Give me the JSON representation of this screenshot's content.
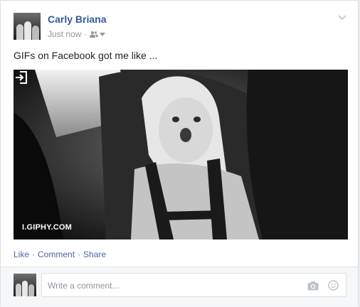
{
  "post": {
    "author": "Carly Briana",
    "timestamp": "Just now",
    "audience_icon": "friends-icon",
    "text": "GIFs on Facebook got me like ...",
    "media": {
      "type": "gif",
      "source_label": "I.GIPHY.COM"
    }
  },
  "actions": {
    "like": "Like",
    "comment": "Comment",
    "share": "Share",
    "separator": "·"
  },
  "comment_box": {
    "placeholder": "Write a comment...",
    "value": ""
  },
  "colors": {
    "link_blue": "#365899",
    "action_blue": "#4b67a1",
    "meta_gray": "#90949c"
  }
}
